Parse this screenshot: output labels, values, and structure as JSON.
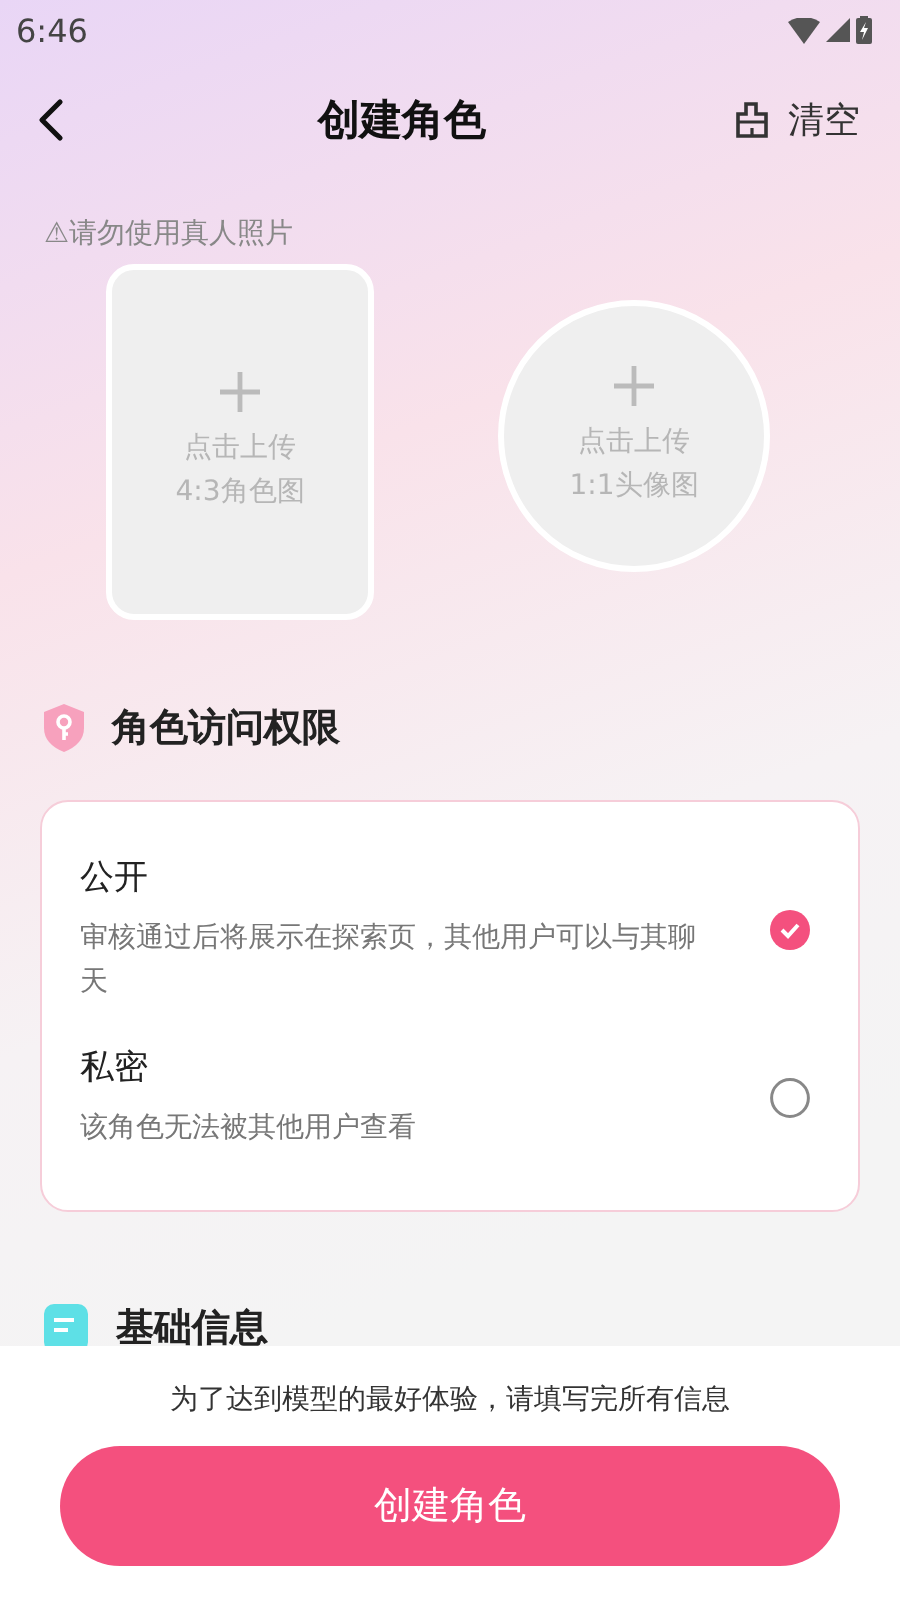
{
  "status_bar": {
    "time": "6:46"
  },
  "header": {
    "title": "创建角色",
    "action": "清空"
  },
  "warning": "⚠请勿使用真人照片",
  "uploads": [
    {
      "kind": "rect",
      "label": "点击上传",
      "sublabel": "4:3角色图"
    },
    {
      "kind": "circle",
      "label": "点击上传",
      "sublabel": "1:1头像图"
    }
  ],
  "access": {
    "title": "角色访问权限",
    "options": [
      {
        "title": "公开",
        "description": "审核通过后将展示在探索页，其他用户可以与其聊天",
        "selected": true
      },
      {
        "title": "私密",
        "description": "该角色无法被其他用户查看",
        "selected": false
      }
    ]
  },
  "basic_info": {
    "title": "基础信息"
  },
  "footer": {
    "hint": "为了达到模型的最好体验，请填写完所有信息",
    "button": "创建角色"
  }
}
